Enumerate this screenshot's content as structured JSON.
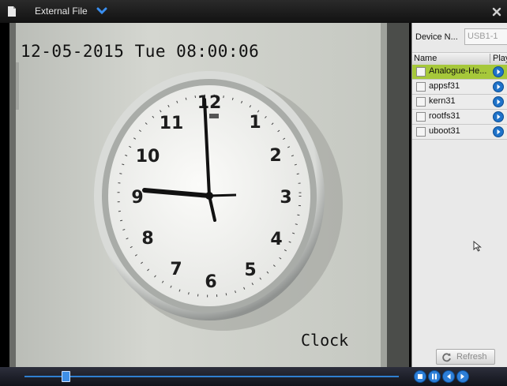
{
  "titlebar": {
    "title": "External File",
    "doc_icon": "document-icon",
    "menu_icon": "chevron-down-icon",
    "close_icon": "close-icon"
  },
  "video": {
    "osd_datetime": "12-05-2015 Tue 08:00:06",
    "osd_channel": "Clock"
  },
  "panel": {
    "device_label": "Device N...",
    "device_value": "USB1-1",
    "columns": {
      "name": "Name",
      "play": "Play"
    },
    "files": [
      {
        "name": "Analogue-He...",
        "selected": true
      },
      {
        "name": "appsf31",
        "selected": false
      },
      {
        "name": "kern31",
        "selected": false
      },
      {
        "name": "rootfs31",
        "selected": false
      },
      {
        "name": "uboot31",
        "selected": false
      }
    ],
    "refresh_label": "Refresh"
  },
  "playback": {
    "progress": 0.11,
    "controls": [
      "stop-icon",
      "pause-icon",
      "rewind-icon",
      "fast-forward-icon"
    ]
  },
  "colors": {
    "accent_blue": "#2f7fd0",
    "selected_row": "#a6c83a"
  }
}
